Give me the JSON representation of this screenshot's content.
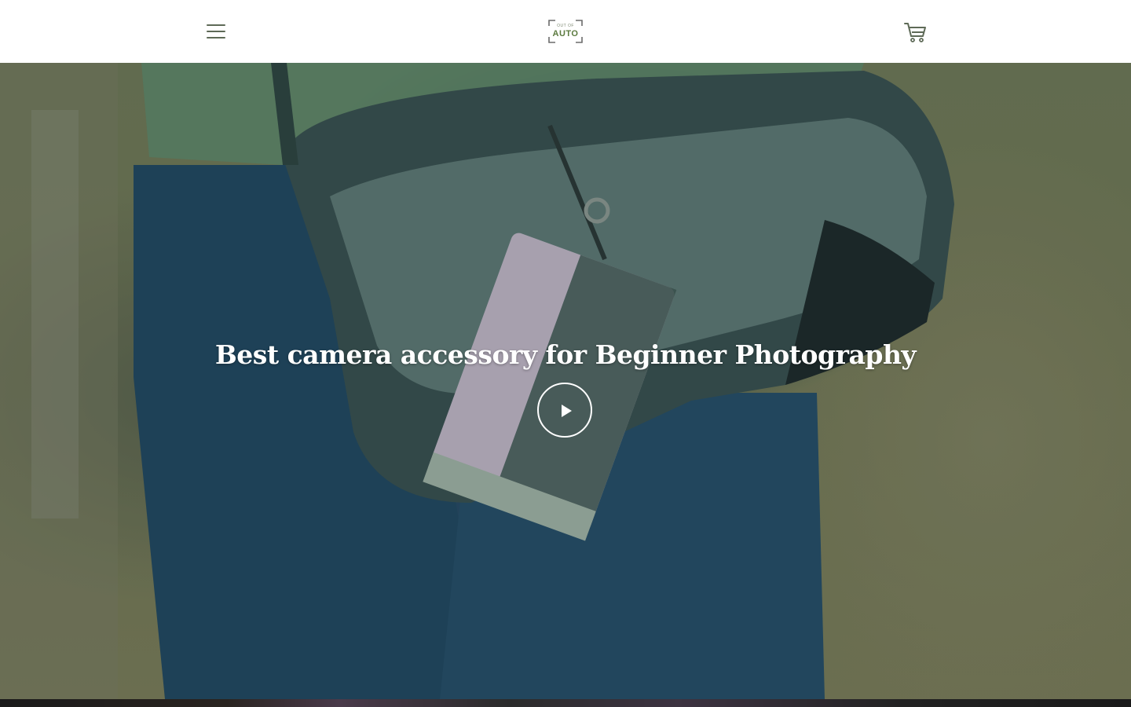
{
  "header": {
    "menu_icon": "hamburger-menu-icon",
    "logo": {
      "small_text": "OUT OF",
      "big_text": "AUTO",
      "alt": "Out of Auto logo"
    },
    "cart_icon": "shopping-cart-icon"
  },
  "hero": {
    "title": "Best camera accessory for Beginner Photography",
    "play_icon": "play-icon"
  },
  "colors": {
    "icon_color": "#5e6a57",
    "logo_green": "#5b7a3e",
    "hero_text": "#ffffff"
  }
}
